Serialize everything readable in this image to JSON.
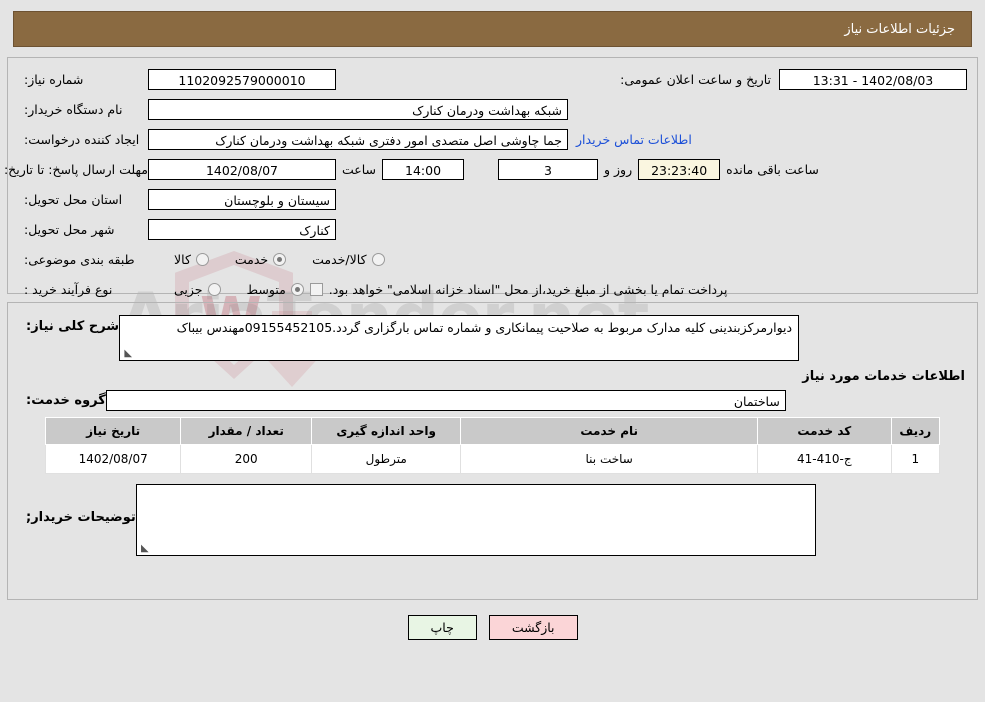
{
  "header": {
    "title": "جزئیات اطلاعات نیاز",
    "bg_color": "#8a6a41",
    "text_color": "#ffffff"
  },
  "form": {
    "need_number": {
      "label": "شماره نیاز:",
      "value": "1102092579000010"
    },
    "buyer_org": {
      "label": "نام دستگاه خریدار:",
      "value": "شبکه بهداشت ودرمان کنارک"
    },
    "requester": {
      "label": "ایجاد کننده درخواست:",
      "value": "جما چاوشی اصل متصدی امور دفتری شبکه بهداشت ودرمان کنارک"
    },
    "buyer_contact_link": {
      "label": "اطلاعات تماس خریدار",
      "color": "#1b4fd8"
    },
    "deadline": {
      "label": "مهلت ارسال پاسخ: تا تاریخ:",
      "date": "1402/08/07",
      "time_label": "ساعت",
      "time": "14:00",
      "days": "3",
      "days_label": "روز و",
      "remaining": "23:23:40",
      "remaining_label": "ساعت باقی مانده"
    },
    "public_announce": {
      "label": "تاریخ و ساعت اعلان عمومی:",
      "value": "1402/08/03 - 13:31"
    },
    "province": {
      "label": "استان محل تحویل:",
      "value": "سیستان و بلوچستان"
    },
    "city": {
      "label": "شهر محل تحویل:",
      "value": "کنارک"
    },
    "category": {
      "label": "طبقه بندی موضوعی:",
      "options": [
        "کالا",
        "خدمت",
        "کالا/خدمت"
      ],
      "selected": "خدمت"
    },
    "purchase_process": {
      "label": "نوع فرآیند خرید :",
      "options": [
        "جزیی",
        "متوسط"
      ],
      "selected": "متوسط",
      "checkbox_label": "پرداخت تمام یا بخشی از مبلغ خرید،از محل \"اسناد خزانه اسلامی\" خواهد بود.",
      "checkbox_checked": false
    }
  },
  "need_description": {
    "label": "شرح کلی نیاز:",
    "value": "دیوارمرکزبندینی کلیه مدارک مربوط به صلاحیت پیمانکاری و شماره تماس بارگزاری گردد.09155452105مهندس بیباک"
  },
  "services_section": {
    "heading": "اطلاعات خدمات مورد نیاز",
    "service_group": {
      "label": "گروه خدمت:",
      "value": "ساختمان"
    },
    "table": {
      "columns": [
        "ردیف",
        "کد خدمت",
        "نام خدمت",
        "واحد اندازه گیری",
        "تعداد / مقدار",
        "تاریخ نیاز"
      ],
      "rows": [
        {
          "row_no": "1",
          "service_code": "ج-410-41",
          "service_name": "ساخت بنا",
          "unit": "مترطول",
          "quantity": "200",
          "need_date": "1402/08/07"
        }
      ]
    }
  },
  "buyer_comments": {
    "label": "توضیحات خریدار;",
    "value": ""
  },
  "buttons": {
    "print": {
      "label": "چاپ",
      "color": "#e8f5e4"
    },
    "back": {
      "label": "بازگشت",
      "color": "#fbd5d7"
    }
  },
  "watermark": {
    "text": "AriaTender.net",
    "letter": "W"
  }
}
